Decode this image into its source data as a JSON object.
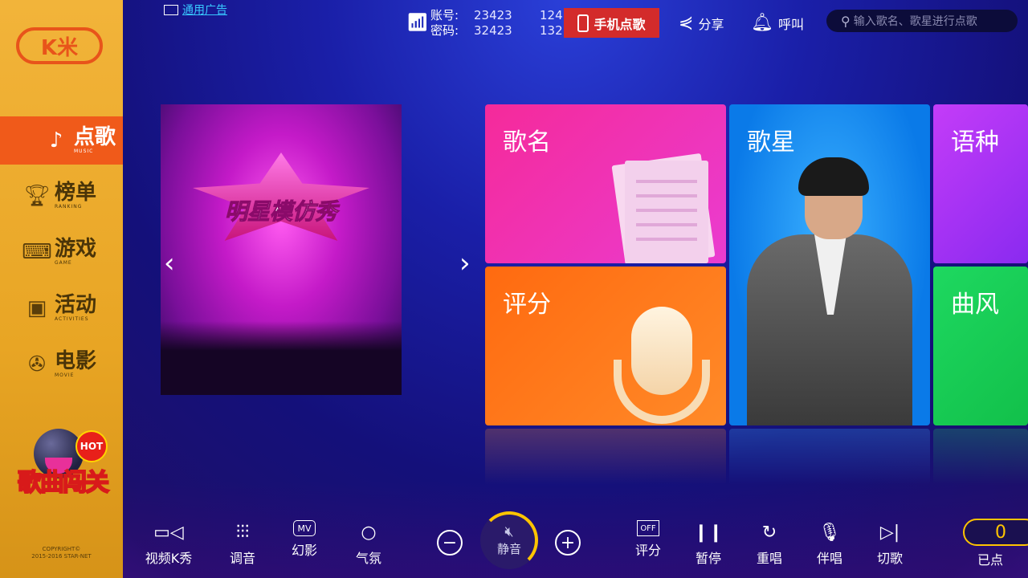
{
  "brand": {
    "logo_text": "K米"
  },
  "sidebar": {
    "items": [
      {
        "label": "点歌",
        "sub": "MUSIC"
      },
      {
        "label": "榜单",
        "sub": "RANKING"
      },
      {
        "label": "游戏",
        "sub": "GAME"
      },
      {
        "label": "活动",
        "sub": "ACTIVITIES"
      },
      {
        "label": "电影",
        "sub": "MOVIE"
      }
    ],
    "promo": {
      "badge": "HOT",
      "title": "歌曲闯关"
    },
    "copyright_line1": "COPYRIGHT©",
    "copyright_line2": "2015-2016 STAR-NET"
  },
  "header": {
    "ad_link": "通用广告",
    "account_label": "账号:",
    "account_value1": "23423",
    "account_value2": "124",
    "password_label": "密码:",
    "password_value1": "32423",
    "password_value2": "132",
    "phone_order": "手机点歌",
    "share": "分享",
    "call": "呼叫",
    "search_placeholder": "输入歌名、歌星进行点歌"
  },
  "banner": {
    "title": "明星模仿秀"
  },
  "tiles": {
    "song_name": "歌名",
    "singer": "歌星",
    "language": "语种",
    "score": "评分",
    "style": "曲风"
  },
  "controls": {
    "video_k": "视频K秀",
    "tune": "调音",
    "phantom": "幻影",
    "atmosphere": "气氛",
    "mute": "静音",
    "score": "评分",
    "score_icon": "OFF",
    "pause": "暂停",
    "replay": "重唱",
    "accompany": "伴唱",
    "skip": "切歌",
    "mv_icon": "MV",
    "queued_count": "0",
    "queued_label": "已点"
  }
}
